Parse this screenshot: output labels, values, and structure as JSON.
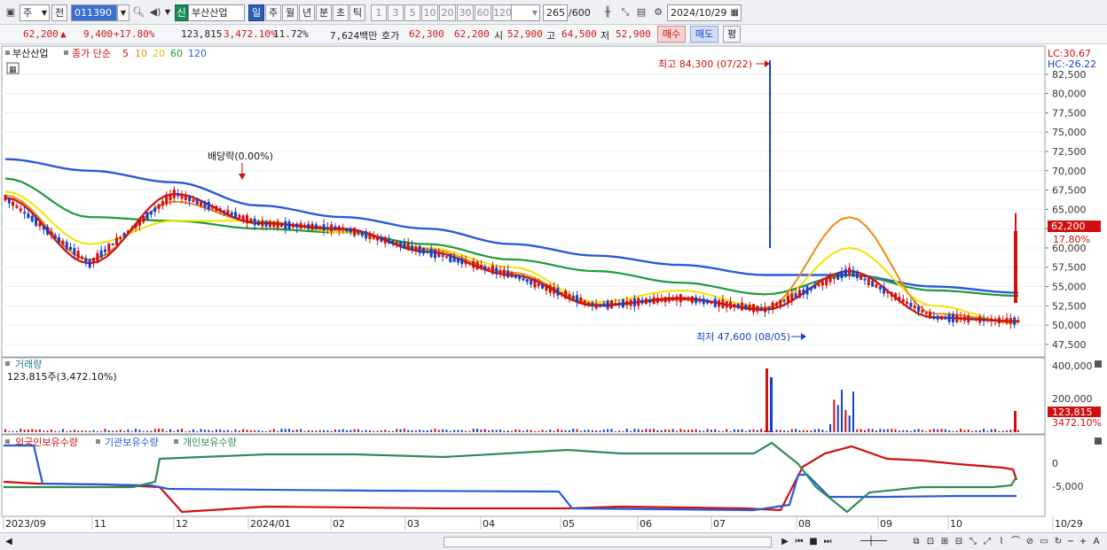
{
  "toolbar": {
    "period_combo": "주",
    "prev_label": "전",
    "stock_code": "011390",
    "market_badge": "신",
    "stock_name": "부산산업",
    "period_tabs": [
      "일",
      "주",
      "월",
      "년",
      "분",
      "초",
      "틱"
    ],
    "active_period": "일",
    "interval_buttons": [
      "1",
      "3",
      "5",
      "10",
      "20",
      "30",
      "60",
      "120"
    ],
    "count_value": "265",
    "count_total": "/600",
    "date_value": "2024/10/29"
  },
  "info": {
    "price": "62,200",
    "change_arrow": "▲",
    "change": "9,400",
    "change_pct": "+17.80%",
    "volume": "123,815",
    "volume_pct": "3,472.10%",
    "turnover_pct": "11.72%",
    "amount": "7,624백만",
    "quote_label": "호가",
    "ask": "62,300",
    "bid": "62,200",
    "open_label": "시",
    "open": "52,900",
    "high_label": "고",
    "high": "64,500",
    "low_label": "저",
    "low": "52,900",
    "buy_label": "매수",
    "sell_label": "매도",
    "eval_label": "평"
  },
  "price_panel": {
    "legend_name": "부산산업",
    "legend_close": "종가 단순",
    "ma_periods": [
      "5",
      "10",
      "20",
      "60",
      "120"
    ],
    "ma_colors": [
      "#d01010",
      "#f08a10",
      "#f2e400",
      "#1f9a3a",
      "#2a5ad8"
    ],
    "lc": "LC:30.67",
    "hc": "HC:-26.22",
    "y_ticks": [
      "82,500",
      "80,000",
      "77,500",
      "75,000",
      "72,500",
      "70,000",
      "67,500",
      "65,000",
      "62,500",
      "60,000",
      "57,500",
      "55,000",
      "52,500",
      "50,000",
      "47,500"
    ],
    "current_price": "62,200",
    "current_pct": "17.80%",
    "dividend_note": "배당락(0.00%)",
    "high_note": "최고 84,300 (07/22)",
    "low_note": "최저 47,600 (08/05)"
  },
  "volume_panel": {
    "title": "거래량",
    "subtitle": "123,815주(3,472.10%)",
    "y_ticks": [
      "400,000",
      "200,000"
    ],
    "current": "123,815",
    "current_pct": "3472.10%"
  },
  "holdings_panel": {
    "series_labels": [
      "외국인보유수량",
      "기관보유수량",
      "개인보유수량"
    ],
    "series_colors": [
      "#d01010",
      "#2a5ad8",
      "#2e8b57"
    ],
    "y_ticks": [
      "0",
      "-5,000"
    ]
  },
  "x_axis": {
    "labels": [
      "2023/09",
      "11",
      "12",
      "2024/01",
      "02",
      "03",
      "04",
      "05",
      "06",
      "07",
      "08",
      "09",
      "10",
      "10/29"
    ]
  },
  "chart_data": {
    "type": "line",
    "title": "",
    "x": [
      "2023/09",
      "11",
      "12",
      "2024/01",
      "02",
      "03",
      "04",
      "05",
      "06",
      "07",
      "08",
      "09",
      "10"
    ],
    "series": [
      {
        "name": "5",
        "values": [
          66500,
          58000,
          67000,
          63200,
          62500,
          59500,
          56500,
          52500,
          53500,
          52000,
          57000,
          51000,
          50500
        ]
      },
      {
        "name": "10",
        "values": [
          66800,
          58500,
          66000,
          63300,
          62300,
          59800,
          56800,
          52700,
          53300,
          52200,
          64000,
          51500,
          50500
        ]
      },
      {
        "name": "20",
        "values": [
          67300,
          60500,
          63500,
          63500,
          62000,
          60000,
          57500,
          53000,
          54500,
          52300,
          60000,
          52500,
          50200
        ]
      },
      {
        "name": "60",
        "values": [
          69000,
          64000,
          63500,
          62500,
          62000,
          60500,
          58500,
          57000,
          55500,
          54000,
          56500,
          54500,
          53800
        ]
      },
      {
        "name": "120",
        "values": [
          71500,
          70000,
          68500,
          65500,
          64000,
          62500,
          60500,
          59000,
          57800,
          56500,
          56500,
          55000,
          54200
        ]
      }
    ],
    "ylim": [
      46000,
      85000
    ]
  }
}
